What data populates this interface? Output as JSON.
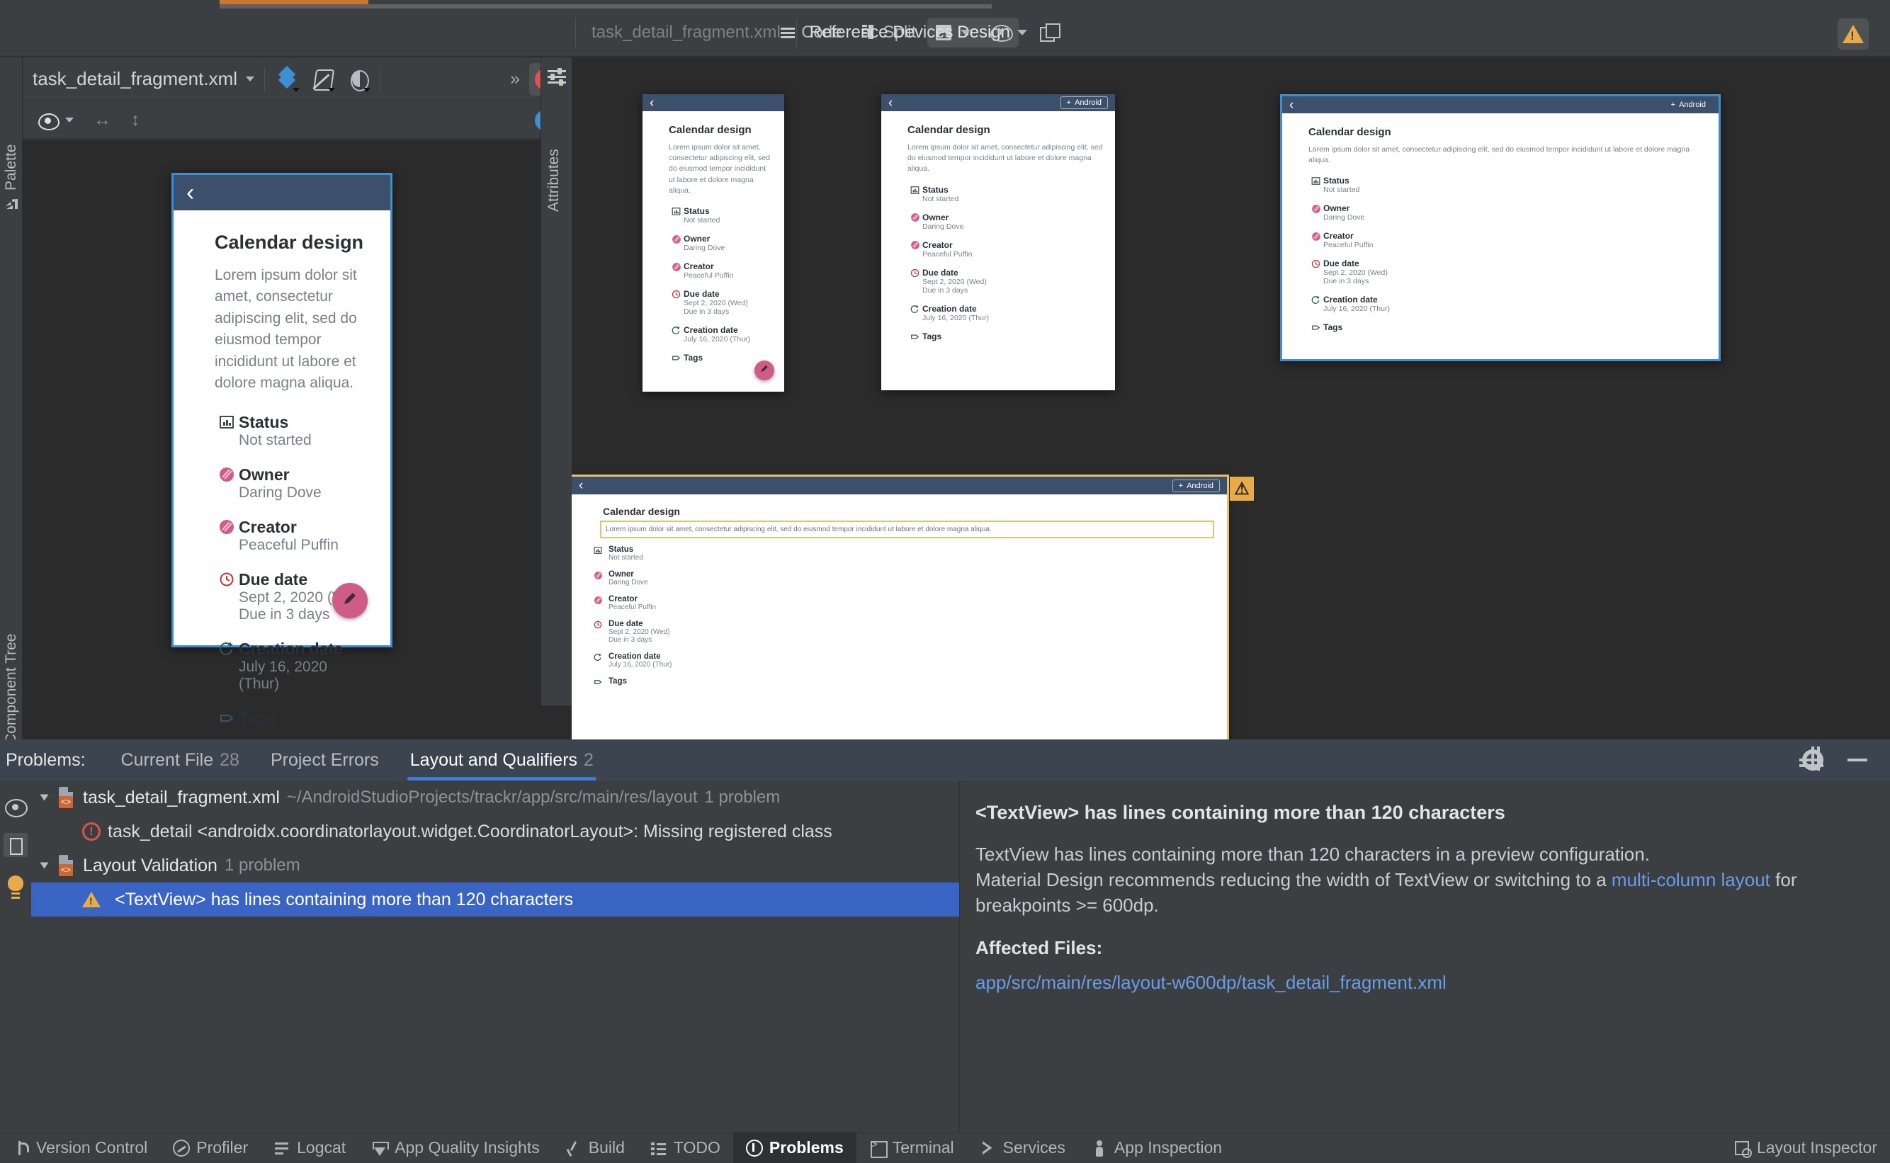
{
  "window": {
    "editor_tab": "task_detail_fragment.xml"
  },
  "mode_bar": {
    "modes": [
      {
        "label": "Code",
        "icon": "code-lines-icon",
        "active": false
      },
      {
        "label": "Split",
        "icon": "split-panes-icon",
        "active": false
      },
      {
        "label": "Design",
        "icon": "design-image-icon",
        "active": true
      }
    ],
    "file_label": "task_detail_fragment.xml",
    "reference_devices": "Reference Devices",
    "icons": [
      "eye-icon",
      "copy-configuration-icon",
      "warning-triangle-icon"
    ]
  },
  "left_rails": {
    "palette": "Palette",
    "component_tree": "Component Tree",
    "attributes": "Attributes"
  },
  "design_toolbar": {
    "file_name": "task_detail_fragment.xml",
    "icons": [
      "layers-icon",
      "blueprint-icon",
      "theme-contrast-icon",
      "chevron-double-right-icon",
      "error-count-icon"
    ],
    "error_badge": "!",
    "second_row_icons": [
      "eye-icon",
      "horizontal-resize-icon",
      "vertical-resize-icon",
      "help-icon"
    ]
  },
  "task_card": {
    "title": "Calendar design",
    "description": "Lorem ipsum dolor sit amet, consectetur adipiscing elit, sed do eiusmod tempor incididunt ut labore et dolore magna aliqua.",
    "back_icon": "back-chevron-icon",
    "android_pill": "Android",
    "android_pill_icon": "plus-icon",
    "fab_icon": "pencil-icon",
    "fields": [
      {
        "icon": "status-bars-icon",
        "label": "Status",
        "values": [
          "Not started"
        ]
      },
      {
        "icon": "owner-avatar-icon",
        "label": "Owner",
        "values": [
          "Daring Dove"
        ]
      },
      {
        "icon": "creator-avatar-icon",
        "label": "Creator",
        "values": [
          "Peaceful Puffin"
        ]
      },
      {
        "icon": "clock-alert-icon",
        "label": "Due date",
        "values": [
          "Sept 2, 2020 (Wed)",
          "Due in 3 days"
        ]
      },
      {
        "icon": "clock-plus-icon",
        "label": "Creation date",
        "values": [
          "July 16, 2020 (Thur)"
        ]
      },
      {
        "icon": "tag-icon",
        "label": "Tags",
        "values": []
      }
    ]
  },
  "previews": [
    {
      "name": "selected-phone-preview",
      "show_appbar_pill": false,
      "show_fab": true,
      "selected": true
    },
    {
      "name": "phone-preview-1",
      "show_appbar_pill": false,
      "show_fab": true,
      "selected": false
    },
    {
      "name": "tablet-preview-1",
      "show_appbar_pill": true,
      "show_fab": false,
      "selected": false
    },
    {
      "name": "tablet-preview-2",
      "show_appbar_pill": true,
      "show_fab": false,
      "selected": false
    },
    {
      "name": "warned-preview",
      "show_appbar_pill": true,
      "show_fab": false,
      "selected": false,
      "warned": true
    }
  ],
  "problems_panel": {
    "title": "Problems:",
    "tabs": [
      {
        "label": "Current File",
        "count": "28",
        "active": false
      },
      {
        "label": "Project Errors",
        "count": "",
        "active": false
      },
      {
        "label": "Layout and Qualifiers",
        "count": "2",
        "active": true
      }
    ],
    "header_icons": [
      "gear-icon",
      "minimize-icon"
    ],
    "rail_icons": [
      "eye-icon",
      "panel-layout-icon",
      "lightbulb-icon"
    ],
    "tree": [
      {
        "kind": "file",
        "name": "task_detail_fragment.xml",
        "path": "~/AndroidStudioProjects/trackr/app/src/main/res/layout",
        "count": "1 problem",
        "icon": "xml-file-icon"
      },
      {
        "kind": "error",
        "message": "task_detail <androidx.coordinatorlayout.widget.CoordinatorLayout>: Missing registered class",
        "icon": "error-icon"
      },
      {
        "kind": "file",
        "name": "Layout Validation",
        "path": "",
        "count": "1 problem",
        "icon": "xml-file-icon"
      },
      {
        "kind": "warning",
        "message": "<TextView> has lines containing more than 120 characters",
        "icon": "warning-icon",
        "selected": true
      }
    ],
    "detail": {
      "title": "<TextView> has lines containing more than 120 characters",
      "paragraph_1": "TextView has lines containing more than 120 characters in a preview configuration.",
      "paragraph_2_before": "Material Design recommends reducing the width of TextView or switching to a ",
      "paragraph_2_link": "multi-column layout",
      "paragraph_2_after": " for breakpoints >= 600dp.",
      "affected_files_label": "Affected Files:",
      "affected_file": "app/src/main/res/layout-w600dp/task_detail_fragment.xml"
    }
  },
  "bottom_tabs": {
    "items": [
      {
        "label": "Version Control",
        "icon": "branch-icon",
        "active": false
      },
      {
        "label": "Profiler",
        "icon": "profiler-icon",
        "active": false
      },
      {
        "label": "Logcat",
        "icon": "logcat-icon",
        "active": false
      },
      {
        "label": "App Quality Insights",
        "icon": "gem-icon",
        "active": false
      },
      {
        "label": "Build",
        "icon": "build-hammer-icon",
        "active": false
      },
      {
        "label": "TODO",
        "icon": "todo-list-icon",
        "active": false
      },
      {
        "label": "Problems",
        "icon": "problems-icon",
        "active": true
      },
      {
        "label": "Terminal",
        "icon": "terminal-icon",
        "active": false
      },
      {
        "label": "Services",
        "icon": "services-play-icon",
        "active": false
      },
      {
        "label": "App Inspection",
        "icon": "app-inspection-icon",
        "active": false
      }
    ],
    "right": {
      "label": "Layout Inspector",
      "icon": "layout-inspector-icon"
    }
  },
  "colors": {
    "app_bg": "#2b2b2b",
    "panel_bg": "#3c3f41",
    "problems_header_bg": "#3c4450",
    "selection_blue": "#3b65c4",
    "accent_blue": "#3d7dd8",
    "link_blue": "#6a9ce8",
    "warning_yellow": "#e8ab4a",
    "error_red": "#d9534f",
    "device_appbar": "#3c4f6b",
    "fab_pink": "#cf5c87",
    "selected_preview_outline": "#3d8fd1"
  }
}
